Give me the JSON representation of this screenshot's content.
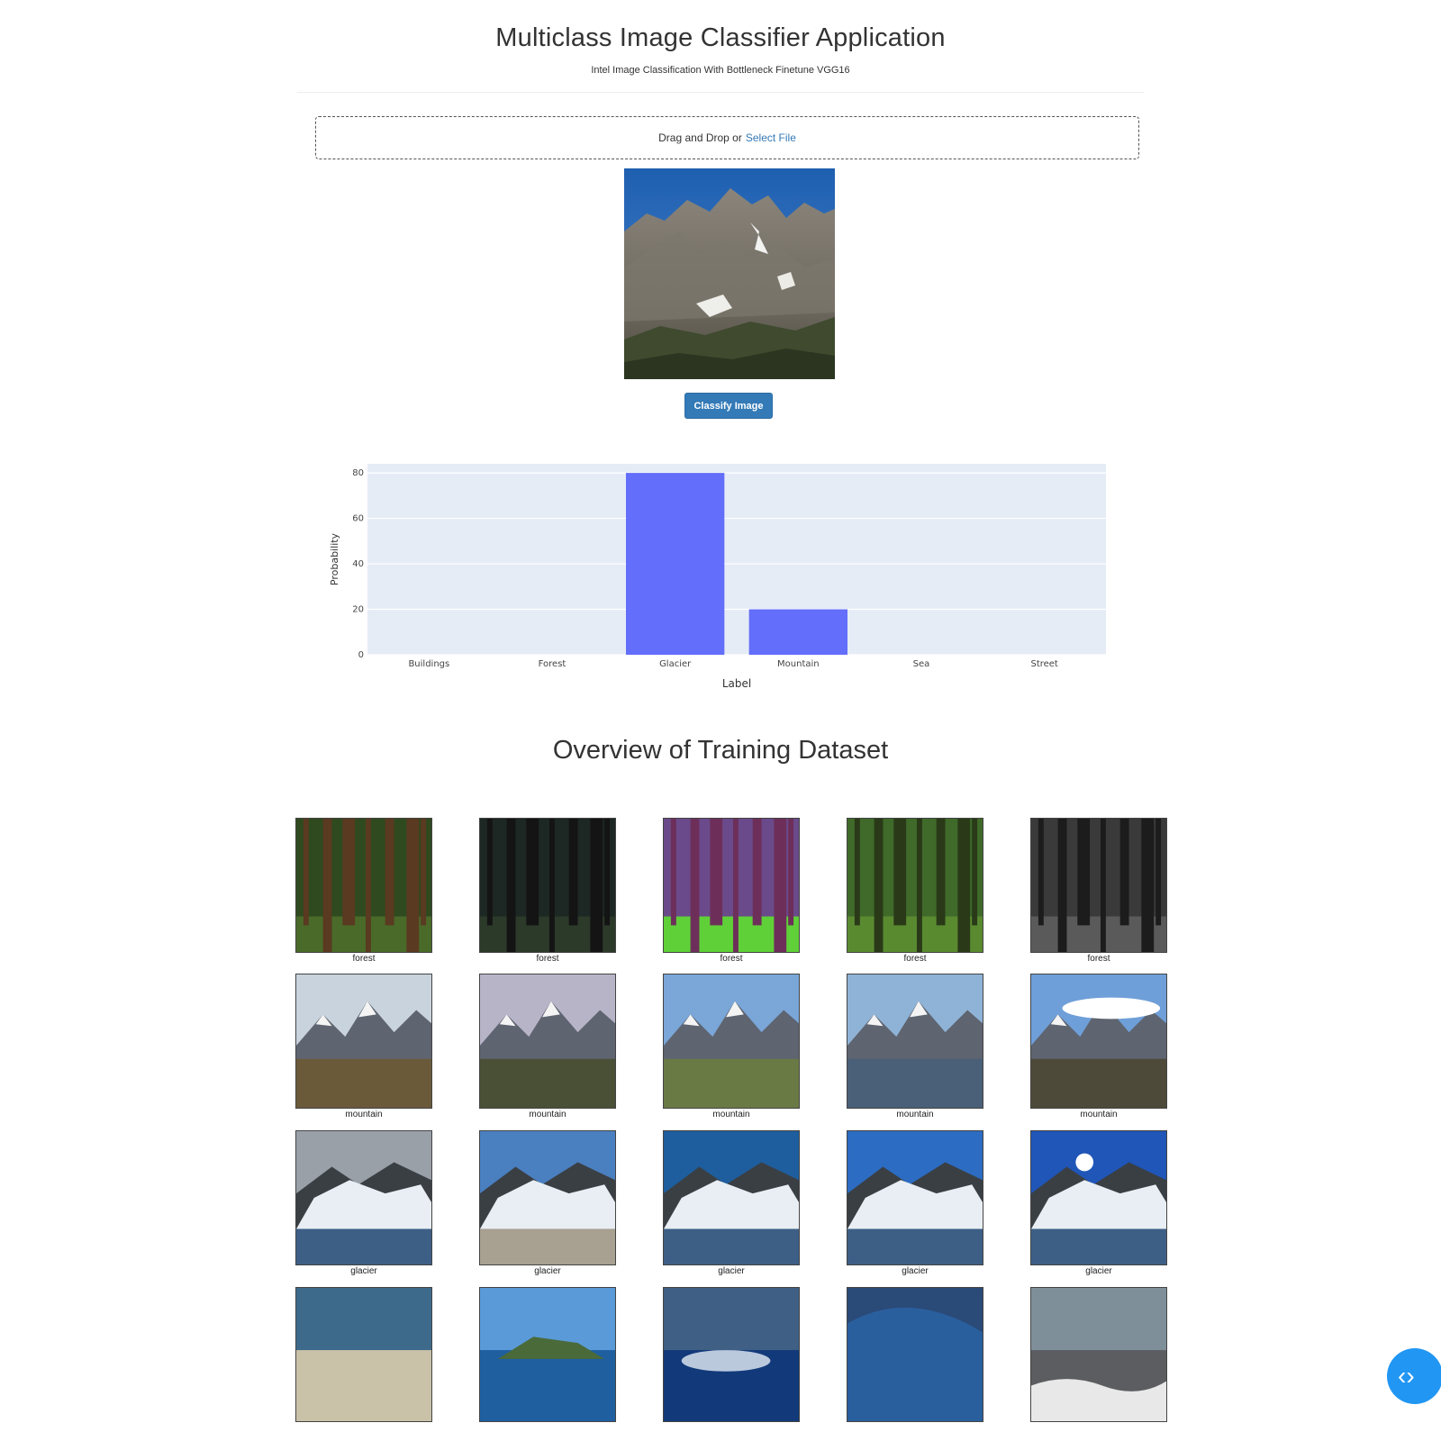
{
  "header": {
    "title": "Multiclass Image Classifier Application",
    "subtitle": "Intel Image Classification With Bottleneck Finetune VGG16"
  },
  "upload": {
    "prompt": "Drag and Drop or",
    "link_label": "Select File"
  },
  "preview_image": {
    "subject": "rocky mountain peak under blue sky"
  },
  "classify_button": {
    "label": "Classify Image"
  },
  "chart_data": {
    "type": "bar",
    "categories": [
      "Buildings",
      "Forest",
      "Glacier",
      "Mountain",
      "Sea",
      "Street"
    ],
    "values": [
      0,
      0,
      80,
      20,
      0,
      0
    ],
    "xlabel": "Label",
    "ylabel": "Probability",
    "ylim": [
      0,
      84
    ],
    "yticks": [
      0,
      20,
      40,
      60,
      80
    ],
    "grid": true,
    "bar_color": "#636efa",
    "plot_bg": "#e5ecf6"
  },
  "overview": {
    "title": "Overview of Training Dataset",
    "rows": [
      {
        "label": "forest",
        "scenes": [
          "forest",
          "forest",
          "forest",
          "forest",
          "forest"
        ]
      },
      {
        "label": "mountain",
        "scenes": [
          "mountain",
          "mountain",
          "mountain",
          "mountain",
          "mountain"
        ]
      },
      {
        "label": "glacier",
        "scenes": [
          "glacier",
          "glacier",
          "glacier",
          "glacier",
          "glacier"
        ]
      },
      {
        "label": "",
        "scenes": [
          "sea",
          "sea",
          "sea",
          "sea",
          "sea"
        ]
      }
    ]
  },
  "nav_button": {
    "icon": "code-arrows-icon"
  },
  "colors": {
    "accent": "#337ab7",
    "fab": "#2196f3"
  }
}
